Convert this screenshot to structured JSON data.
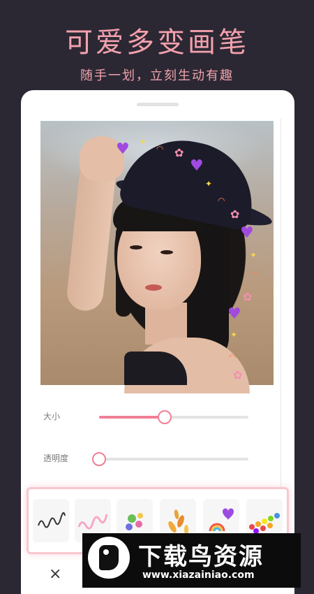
{
  "header": {
    "title": "可爱多变画笔",
    "subtitle": "随手一划，立刻生动有趣"
  },
  "editor": {
    "sliders": [
      {
        "label": "大小",
        "value_percent": 44
      },
      {
        "label": "透明度",
        "value_percent": 0
      }
    ],
    "brushes": [
      {
        "name": "squiggle-dark",
        "selected": false
      },
      {
        "name": "squiggle-pink",
        "selected": false
      },
      {
        "name": "flowers",
        "selected": false
      },
      {
        "name": "leaves",
        "selected": false
      },
      {
        "name": "heart-rainbow",
        "selected": false
      },
      {
        "name": "rainbow-dots",
        "selected": false
      }
    ],
    "close_glyph": "×",
    "stickers": {
      "heart": "♥",
      "flower": "✿",
      "spark": "✦",
      "rainbow": "◠"
    }
  },
  "watermark": {
    "title": "下载鸟资源",
    "url": "www.xiazainiao.com"
  },
  "colors": {
    "background": "#2b2833",
    "accent_pink": "#f07f95",
    "heading_pink": "#f3a0ad"
  }
}
